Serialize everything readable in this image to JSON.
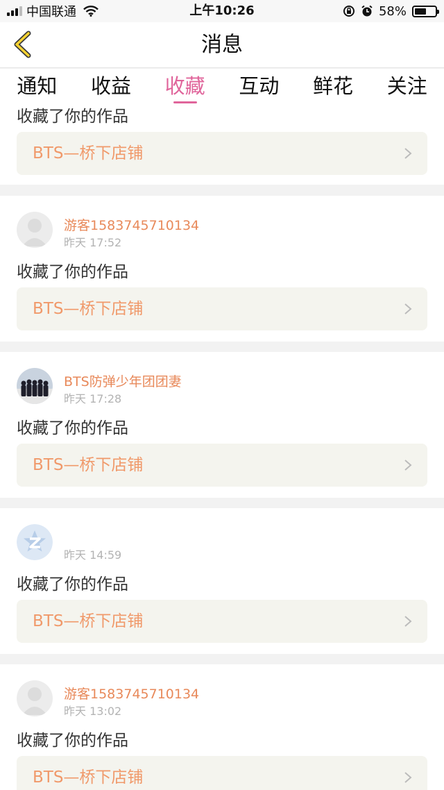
{
  "status_bar": {
    "carrier": "中国联通",
    "time": "上午10:26",
    "battery": "58%",
    "battery_level": 0.58
  },
  "header": {
    "title": "消息",
    "back_icon": "chevron-left-icon"
  },
  "tabs": [
    {
      "label": "通知",
      "active": false
    },
    {
      "label": "收益",
      "active": false
    },
    {
      "label": "收藏",
      "active": true
    },
    {
      "label": "互动",
      "active": false
    },
    {
      "label": "鲜花",
      "active": false
    },
    {
      "label": "关注",
      "active": false
    }
  ],
  "items": [
    {
      "user": "",
      "time": "",
      "action": "收藏了你的作品",
      "work": "BTS—桥下店铺",
      "avatar": "none"
    },
    {
      "user": "游客1583745710134",
      "time": "昨天 17:52",
      "action": "收藏了你的作品",
      "work": "BTS—桥下店铺",
      "avatar": "default-avatar"
    },
    {
      "user": "BTS防弹少年团团妻",
      "time": "昨天 17:28",
      "action": "收藏了你的作品",
      "work": "BTS—桥下店铺",
      "avatar": "group-photo-avatar"
    },
    {
      "user": "",
      "time": "昨天 14:59",
      "action": "收藏了你的作品",
      "work": "BTS—桥下店铺",
      "avatar": "qq-logo-avatar"
    },
    {
      "user": "游客1583745710134",
      "time": "昨天 13:02",
      "action": "收藏了你的作品",
      "work": "BTS—桥下店铺",
      "avatar": "default-avatar"
    }
  ],
  "colors": {
    "accent": "#e0659b",
    "username": "#e8895a",
    "link_text": "#f0996a",
    "link_bg": "#f4f4ee"
  }
}
